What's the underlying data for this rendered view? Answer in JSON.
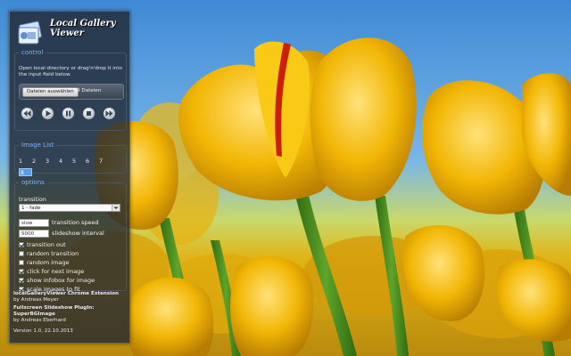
{
  "app": {
    "title_line1": "Local Gallery",
    "title_line2": "Viewer",
    "logo_icon": "gallery-logo-icon"
  },
  "control": {
    "legend": "control",
    "hint": "Open local directory or drag'n'drop it into the input field below.",
    "file_button": "Dateien auswählen",
    "file_count": "9 Dateien",
    "buttons": [
      {
        "name": "previous-button",
        "icon": "rewind-icon"
      },
      {
        "name": "play-button",
        "icon": "play-icon"
      },
      {
        "name": "pause-button",
        "icon": "pause-icon"
      },
      {
        "name": "stop-button",
        "icon": "stop-icon"
      },
      {
        "name": "next-button",
        "icon": "fast-forward-icon"
      }
    ]
  },
  "image_list": {
    "legend": "Image List",
    "numbers": [
      "1",
      "2",
      "3",
      "4",
      "5",
      "6",
      "7"
    ],
    "current_value": "8"
  },
  "options": {
    "legend": "options",
    "transition_label": "transition",
    "transition_value": "1 - fade",
    "transition_speed_value": "slow",
    "transition_speed_label": "transition speed",
    "slideshow_interval_value": "5000",
    "slideshow_interval_label": "slideshow interval",
    "checkboxes": [
      {
        "label": "transition out",
        "checked": true
      },
      {
        "label": "random transition",
        "checked": false
      },
      {
        "label": "random image",
        "checked": false
      },
      {
        "label": "click for next image",
        "checked": true
      },
      {
        "label": "show infobox for image",
        "checked": true
      },
      {
        "label": "scale images to fit",
        "checked": true
      }
    ]
  },
  "credits": {
    "line1_bold": "localGalleryViewer Chrome Extension",
    "line1_rest": "by Andreas Meyer",
    "line2_bold": "Fullscreen Slideshow PlugIn: SuperBGImage",
    "line2_rest": "by Andreas Eberhard",
    "version": "Version 1.0, 22.10.2013"
  },
  "colors": {
    "panel_bg": "#202630",
    "legend_text": "#7fb2ff",
    "selected_input": "#5a9be6",
    "tulip_yellow": "#f2b705"
  }
}
